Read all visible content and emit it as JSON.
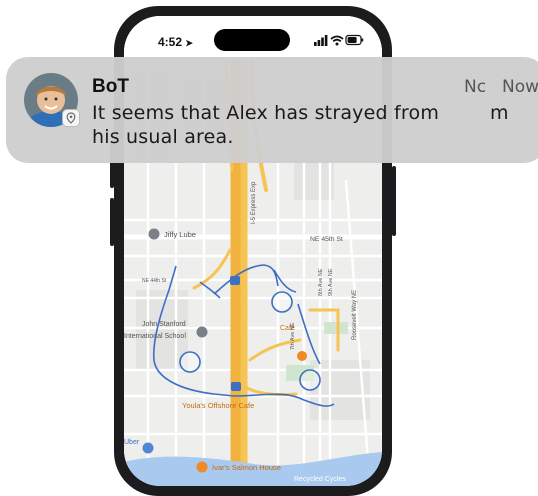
{
  "status_bar": {
    "time": "4:52"
  },
  "notification": {
    "app_title": "BoT",
    "time_behind": "Nc",
    "time_front": "Now",
    "message_line1": "It seems that Alex has strayed from",
    "message_line2": "his usual area.",
    "stacked_fragment": "m"
  },
  "map": {
    "streets": [
      "NE 45th St",
      "NE 44th St",
      "7th Ave NE",
      "8th Ave NE",
      "9th Ave NE",
      "Roosevelt Way NE",
      "I-5 Express Exp"
    ],
    "places": {
      "jiffy_lube": "Jiffy Lube",
      "john_stanford_1": "John Stanford",
      "john_stanford_2": "International School",
      "youlas": "Youla's Offshore Cafe",
      "ivars": "Ivar's Salmon House",
      "recycled_cycles": "Recycled Cycles",
      "cafe": "Cafe",
      "uber": "Uber"
    },
    "colors": {
      "route": "#3d6fc4",
      "highway": "#f1b23f",
      "water": "#a9c9ee"
    }
  }
}
